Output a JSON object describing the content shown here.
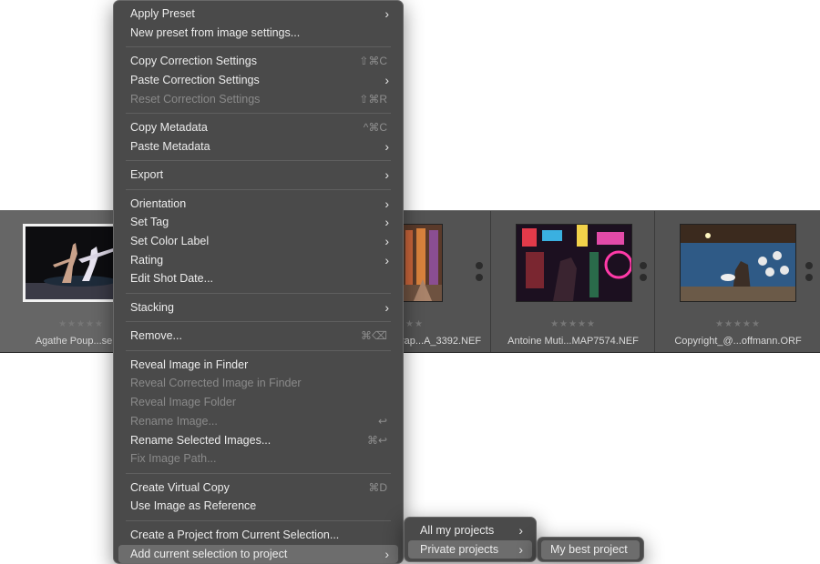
{
  "filmstrip": {
    "cells": [
      {
        "filename": "Agathe Poup...seleA",
        "rating": "★★★★★"
      },
      {
        "filename": "rap...A_3392.NEF",
        "rating": "★★★★★"
      },
      {
        "filename": "Antoine Muti...MAP7574.NEF",
        "rating": "★★★★★"
      },
      {
        "filename": "Copyright_@...offmann.ORF",
        "rating": "★★★★★"
      }
    ]
  },
  "context_menu": {
    "apply_preset": "Apply Preset",
    "new_preset": "New preset from image settings...",
    "copy_correction": "Copy Correction Settings",
    "copy_correction_sc": "⇧⌘C",
    "paste_correction": "Paste Correction Settings",
    "reset_correction": "Reset Correction Settings",
    "reset_correction_sc": "⇧⌘R",
    "copy_metadata": "Copy Metadata",
    "copy_metadata_sc": "^⌘C",
    "paste_metadata": "Paste Metadata",
    "export": "Export",
    "orientation": "Orientation",
    "set_tag": "Set Tag",
    "set_color_label": "Set Color Label",
    "rating": "Rating",
    "edit_shot_date": "Edit Shot Date...",
    "stacking": "Stacking",
    "remove": "Remove...",
    "remove_sc": "⌘⌫",
    "reveal_image": "Reveal Image in Finder",
    "reveal_corrected": "Reveal Corrected Image in Finder",
    "reveal_folder": "Reveal Image Folder",
    "rename_image": "Rename Image...",
    "rename_image_sc": "↩",
    "rename_selected": "Rename Selected Images...",
    "rename_selected_sc": "⌘↩",
    "fix_path": "Fix Image Path...",
    "create_virtual": "Create Virtual Copy",
    "create_virtual_sc": "⌘D",
    "use_reference": "Use Image as Reference",
    "create_project": "Create a Project from Current Selection...",
    "add_to_project": "Add current selection to project",
    "chevron": "›"
  },
  "submenu_projects": {
    "all_projects": "All my projects",
    "private_projects": "Private projects"
  },
  "submenu_private": {
    "my_best_project": "My best project"
  }
}
